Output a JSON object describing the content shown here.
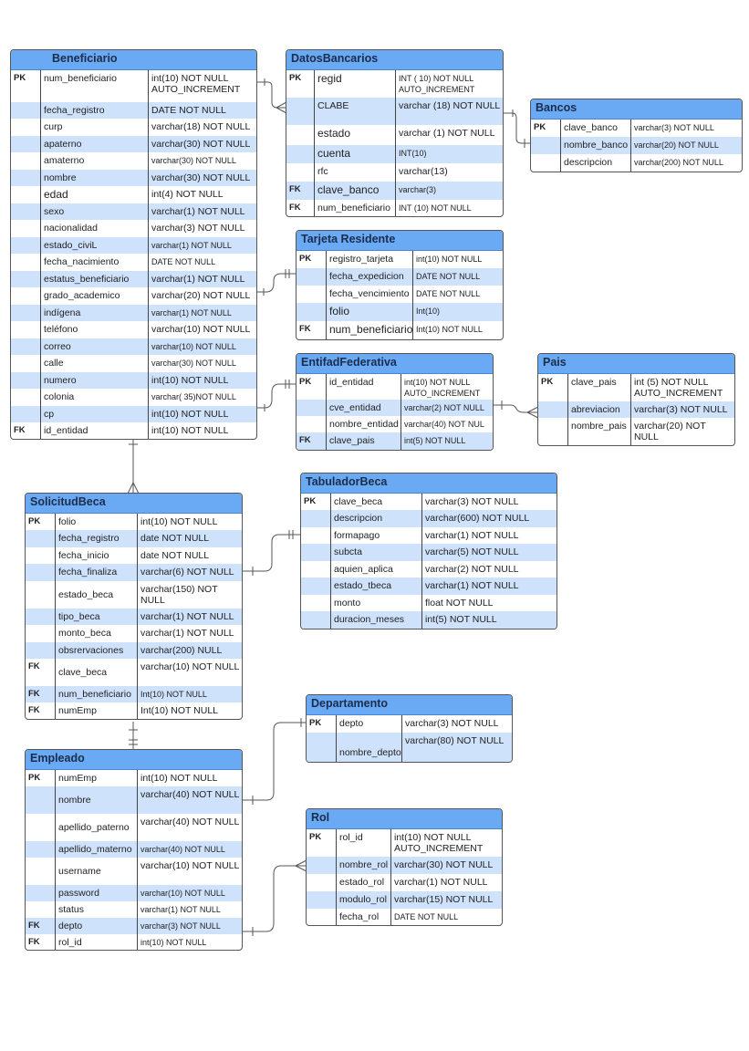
{
  "diagram_title": "",
  "tables": [
    {
      "id": "beneficiario",
      "name": "Beneficiario",
      "rows": [
        {
          "key": "PK",
          "column": "num_beneficiario",
          "type": "int(10) NOT NULL AUTO_INCREMENT"
        },
        {
          "key": "",
          "column": "fecha_registro",
          "type": " DATE NOT NULL"
        },
        {
          "key": "",
          "column": "curp",
          "type": "varchar(18) NOT NULL"
        },
        {
          "key": "",
          "column": "apaterno",
          "type": "varchar(30) NOT NULL"
        },
        {
          "key": "",
          "column": "amaterno",
          "type": "varchar(30) NOT NULL"
        },
        {
          "key": "",
          "column": "nombre",
          "type": "varchar(30) NOT NULL"
        },
        {
          "key": "",
          "column": "edad",
          "type": " int(4) NOT NULL"
        },
        {
          "key": "",
          "column": "sexo",
          "type": "varchar(1) NOT NULL"
        },
        {
          "key": "",
          "column": "nacionalidad",
          "type": "varchar(3) NOT NULL"
        },
        {
          "key": "",
          "column": "estado_civiL",
          "type": "varchar(1) NOT NULL"
        },
        {
          "key": "",
          "column": "fecha_nacimiento",
          "type": "DATE  NOT NULL"
        },
        {
          "key": "",
          "column": "estatus_beneficiario",
          "type": "varchar(1) NOT NULL"
        },
        {
          "key": "",
          "column": "grado_academico",
          "type": "varchar(20) NOT NULL"
        },
        {
          "key": "",
          "column": "indígena",
          "type": "varchar(1) NOT NULL"
        },
        {
          "key": "",
          "column": "teléfono",
          "type": "varchar(10) NOT NULL"
        },
        {
          "key": "",
          "column": "correo",
          "type": "varchar(10) NOT NULL"
        },
        {
          "key": "",
          "column": "calle",
          "type": "varchar(30) NOT NULL"
        },
        {
          "key": "",
          "column": "numero",
          "type": "int(10) NOT NULL"
        },
        {
          "key": "",
          "column": "colonia",
          "type": "varchar( 35)NOT NULL"
        },
        {
          "key": "",
          "column": "cp",
          "type": "int(10) NOT NULL"
        },
        {
          "key": "FK",
          "column": "id_entidad",
          "type": "int(10) NOT NULL"
        }
      ]
    },
    {
      "id": "datosbancarios",
      "name": "DatosBancarios",
      "rows": [
        {
          "key": "PK",
          "column": "regid",
          "type": "INT ( 10)      NOT NULL AUTO_INCREMENT"
        },
        {
          "key": "",
          "column": "CLABE",
          "type": "varchar (18) NOT NULL"
        },
        {
          "key": "",
          "column": "estado",
          "type": "varchar (1) NOT NULL"
        },
        {
          "key": "",
          "column": "cuenta",
          "type": "INT(10)"
        },
        {
          "key": "",
          "column": "rfc",
          "type": "varchar(13)"
        },
        {
          "key": "FK",
          "column": "clave_banco",
          "type": "varchar(3)"
        },
        {
          "key": "FK",
          "column": "num_beneficiario",
          "type": "INT (10) NOT NULL"
        }
      ]
    },
    {
      "id": "bancos",
      "name": "Bancos",
      "rows": [
        {
          "key": "PK",
          "column": "clave_banco",
          "type": "varchar(3) NOT NULL"
        },
        {
          "key": "",
          "column": "nombre_banco",
          "type": "varchar(20) NOT NULL"
        },
        {
          "key": "",
          "column": "descripcion",
          "type": "varchar(200) NOT NULL"
        }
      ]
    },
    {
      "id": "tarjetaresidente",
      "name": "Tarjeta Residente",
      "rows": [
        {
          "key": "PK",
          "column": "registro_tarjeta",
          "type": "int(10) NOT NULL"
        },
        {
          "key": "",
          "column": "fecha_expedicion",
          "type": "DATE NOT NULL"
        },
        {
          "key": "",
          "column": "fecha_vencimiento",
          "type": "DATE NOT NULL"
        },
        {
          "key": "",
          "column": "folio",
          "type": "Int(10)"
        },
        {
          "key": "FK",
          "column": "num_beneficiario",
          "type": "Int(10) NOT NULL"
        }
      ]
    },
    {
      "id": "entidadfederativa",
      "name": "EntifadFederativa",
      "rows": [
        {
          "key": "PK",
          "column": "id_entidad",
          "type": "int(10) NOT NULL AUTO_INCREMENT"
        },
        {
          "key": "",
          "column": "cve_entidad",
          "type": "varchar(2) NOT NULL"
        },
        {
          "key": "",
          "column": "nombre_entidad",
          "type": "varchar(40) NOT NUL"
        },
        {
          "key": "FK",
          "column": "clave_pais",
          "type": "int(5) NOT NULL"
        }
      ]
    },
    {
      "id": "pais",
      "name": "Pais",
      "rows": [
        {
          "key": "PK",
          "column": " clave_pais",
          "type": "int (5) NOT NULL AUTO_INCREMENT"
        },
        {
          "key": "",
          "column": "abreviacion",
          "type": "varchar(3) NOT NULL"
        },
        {
          "key": "",
          "column": "nombre_pais",
          "type": "varchar(20) NOT NULL"
        }
      ]
    },
    {
      "id": "solicitudbeca",
      "name": "SolicitudBeca",
      "rows": [
        {
          "key": "PK",
          "column": "folio",
          "type": "int(10) NOT NULL"
        },
        {
          "key": "",
          "column": "fecha_registro",
          "type": "date NOT NULL"
        },
        {
          "key": "",
          "column": "fecha_inicio",
          "type": "date NOT NULL"
        },
        {
          "key": "",
          "column": "fecha_finaliza",
          "type": "varchar(6) NOT NULL"
        },
        {
          "key": "",
          "column": "estado_beca",
          "type": "varchar(150) NOT NULL"
        },
        {
          "key": "",
          "column": "tipo_beca",
          "type": "varchar(1) NOT NULL"
        },
        {
          "key": "",
          "column": "monto_beca",
          "type": "varchar(1) NOT NULL"
        },
        {
          "key": "",
          "column": "obsrervaciones",
          "type": "varchar(200) NULL"
        },
        {
          "key": "FK",
          "column": "clave_beca",
          "type": "varchar(10) NOT NULL"
        },
        {
          "key": "FK",
          "column": "num_beneficiario",
          "type": "Int(10) NOT NULL"
        },
        {
          "key": "FK",
          "column": "numEmp",
          "type": "Int(10) NOT NULL"
        }
      ]
    },
    {
      "id": "tabuladorbeca",
      "name": "TabuladorBeca",
      "rows": [
        {
          "key": "PK",
          "column": "clave_beca",
          "type": "varchar(3) NOT NULL"
        },
        {
          "key": "",
          "column": "descripcion",
          "type": "varchar(600) NOT NULL"
        },
        {
          "key": "",
          "column": "formapago",
          "type": "varchar(1) NOT NULL"
        },
        {
          "key": "",
          "column": "subcta",
          "type": "varchar(5) NOT NULL"
        },
        {
          "key": "",
          "column": "aquien_aplica",
          "type": "varchar(2) NOT NULL"
        },
        {
          "key": "",
          "column": "estado_tbeca",
          "type": "varchar(1) NOT NULL"
        },
        {
          "key": "",
          "column": "monto",
          "type": "float NOT NULL"
        },
        {
          "key": "",
          "column": "duracion_meses",
          "type": "int(5) NOT NULL"
        }
      ]
    },
    {
      "id": "empleado",
      "name": "Empleado",
      "rows": [
        {
          "key": "PK",
          "column": "numEmp",
          "type": " int(10) NOT NULL"
        },
        {
          "key": "",
          "column": "nombre",
          "type": "varchar(40) NOT NULL"
        },
        {
          "key": "",
          "column": "apellido_paterno",
          "type": "varchar(40) NOT NULL"
        },
        {
          "key": "",
          "column": "apellido_materno",
          "type": "varchar(40) NOT NULL"
        },
        {
          "key": "",
          "column": "username",
          "type": "varchar(10) NOT NULL"
        },
        {
          "key": "",
          "column": "password",
          "type": "varchar(10) NOT NULL"
        },
        {
          "key": "",
          "column": "status",
          "type": "varchar(1) NOT NULL"
        },
        {
          "key": "FK",
          "column": "depto",
          "type": " varchar(3) NOT NULL"
        },
        {
          "key": "FK",
          "column": "rol_id",
          "type": "int(10) NOT NULL"
        }
      ]
    },
    {
      "id": "departamento",
      "name": "Departamento",
      "rows": [
        {
          "key": "PK",
          "column": "depto",
          "type": "varchar(3) NOT NULL"
        },
        {
          "key": "",
          "column": "nombre_depto",
          "type": "varchar(80) NOT NULL"
        }
      ]
    },
    {
      "id": "rol",
      "name": "Rol",
      "rows": [
        {
          "key": "PK",
          "column": "rol_id",
          "type": "int(10) NOT NULL AUTO_INCREMENT"
        },
        {
          "key": "",
          "column": "nombre_rol",
          "type": "varchar(30) NOT NULL"
        },
        {
          "key": "",
          "column": "estado_rol",
          "type": "varchar(1) NOT NULL"
        },
        {
          "key": "",
          "column": "modulo_rol",
          "type": "varchar(15) NOT NULL"
        },
        {
          "key": "",
          "column": "fecha_rol",
          "type": "DATE NOT NULL"
        }
      ]
    }
  ],
  "relationships": [
    {
      "from": "Beneficiario",
      "to": "DatosBancarios",
      "from_end": "one",
      "to_end": "many"
    },
    {
      "from": "Bancos",
      "to": "DatosBancarios",
      "from_end": "one",
      "to_end": "one"
    },
    {
      "from": "Beneficiario",
      "to": "Tarjeta Residente",
      "from_end": "one",
      "to_end": "one-mandatory"
    },
    {
      "from": "Beneficiario",
      "to": "EntifadFederativa",
      "from_end": "one",
      "to_end": "one-mandatory"
    },
    {
      "from": "EntifadFederativa",
      "to": "Pais",
      "from_end": "one",
      "to_end": "many"
    },
    {
      "from": "Beneficiario",
      "to": "SolicitudBeca",
      "from_end": "one",
      "to_end": "many"
    },
    {
      "from": "SolicitudBeca",
      "to": "TabuladorBeca",
      "from_end": "one",
      "to_end": "one-mandatory"
    },
    {
      "from": "SolicitudBeca",
      "to": "Empleado",
      "from_end": "one",
      "to_end": "one-mandatory"
    },
    {
      "from": "Empleado",
      "to": "Departamento",
      "from_end": "one",
      "to_end": "one"
    },
    {
      "from": "Empleado",
      "to": "Rol",
      "from_end": "one",
      "to_end": "many"
    }
  ],
  "colors": {
    "header": "#6aa9f4",
    "alt_row": "#cfe2fb",
    "border": "#555555",
    "line": "#555555"
  }
}
